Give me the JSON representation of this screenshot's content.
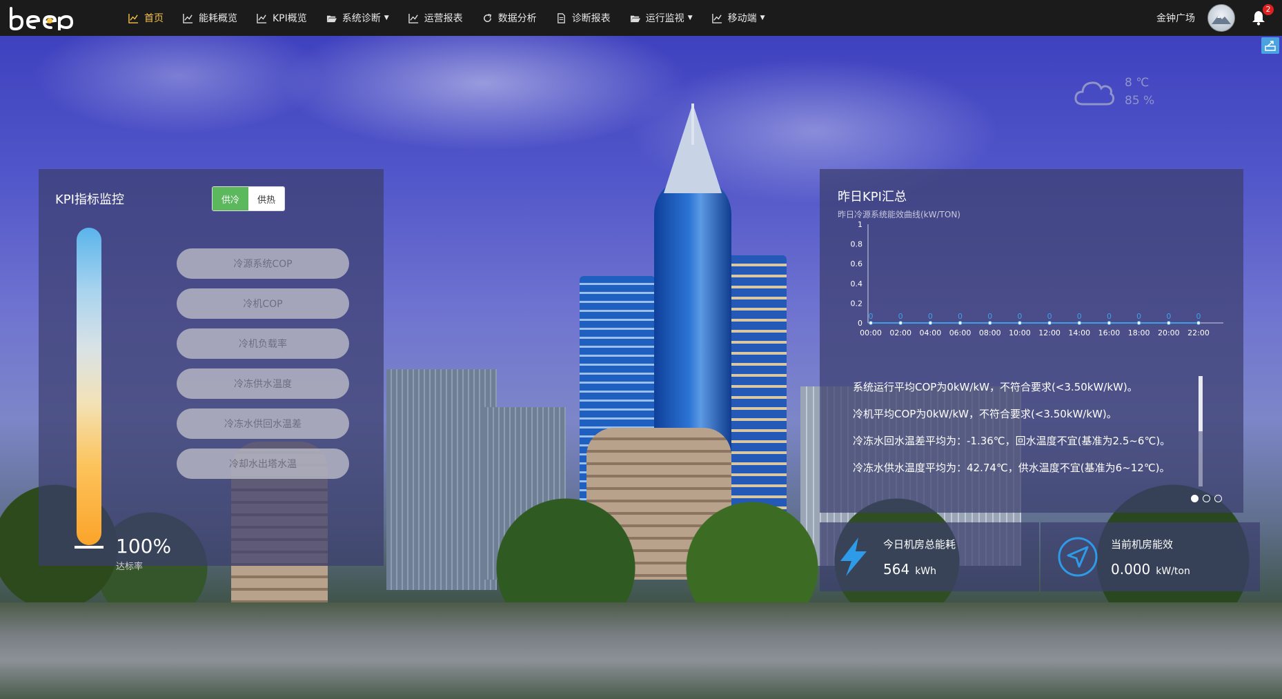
{
  "nav": {
    "logo_text": "beep",
    "items": [
      {
        "label": "首页",
        "icon": "chart-line-icon",
        "active": true
      },
      {
        "label": "能耗概览",
        "icon": "chart-line-icon"
      },
      {
        "label": "KPI概览",
        "icon": "chart-line-icon"
      },
      {
        "label": "系统诊断",
        "icon": "folder-open-icon",
        "dropdown": true
      },
      {
        "label": "运营报表",
        "icon": "chart-line-icon"
      },
      {
        "label": "数据分析",
        "icon": "refresh-icon"
      },
      {
        "label": "诊断报表",
        "icon": "file-icon"
      },
      {
        "label": "运行监视",
        "icon": "folder-open-icon",
        "dropdown": true
      },
      {
        "label": "移动端",
        "icon": "chart-line-icon",
        "dropdown": true
      }
    ],
    "site_name": "金钟广场",
    "notification_count": "2"
  },
  "weather": {
    "temperature": "8 ℃",
    "humidity": "85 %"
  },
  "kpi_panel": {
    "title": "KPI指标监控",
    "toggle": {
      "on": "供冷",
      "off": "供热"
    },
    "buttons": [
      "冷源系统COP",
      "冷机COP",
      "冷机负载率",
      "冷冻供水温度",
      "冷冻水供回水温差",
      "冷却水出塔水温"
    ],
    "rate_value": "100%",
    "rate_label": "达标率"
  },
  "yesterday_panel": {
    "title": "昨日KPI汇总",
    "subtitle": "昨日冷源系统能效曲线(kW/TON)",
    "messages": [
      "系统运行平均COP为0kW/kW，不符合要求(<3.50kW/kW)。",
      "冷机平均COP为0kW/kW，不符合要求(<3.50kW/kW)。",
      "冷冻水回水温差平均为：-1.36℃，回水温度不宜(基准为2.5~6℃)。",
      "冷冻水供水温度平均为：42.74℃，供水温度不宜(基准为6~12℃)。"
    ]
  },
  "stats": {
    "energy_label": "今日机房总能耗",
    "energy_value": "564",
    "energy_unit": "kWh",
    "efficiency_label": "当前机房能效",
    "efficiency_value": "0.000",
    "efficiency_unit": "kW/ton"
  },
  "colors": {
    "nav_bg": "#1b1b1b",
    "nav_active": "#f6c343",
    "toggle_on": "#5cb85c",
    "chart_line": "#3fa0e6",
    "accent_blue": "#2d9be8"
  },
  "chart_data": {
    "type": "line",
    "x": [
      "00:00",
      "02:00",
      "04:00",
      "06:00",
      "08:00",
      "10:00",
      "12:00",
      "14:00",
      "16:00",
      "18:00",
      "20:00",
      "22:00"
    ],
    "series": [
      {
        "values": [
          0,
          0,
          0,
          0,
          0,
          0,
          0,
          0,
          0,
          0,
          0,
          0
        ]
      }
    ],
    "ylim": [
      0,
      1
    ],
    "yticks": [
      0,
      0.2,
      0.4,
      0.6,
      0.8,
      1
    ],
    "data_labels": true,
    "grid": false
  }
}
